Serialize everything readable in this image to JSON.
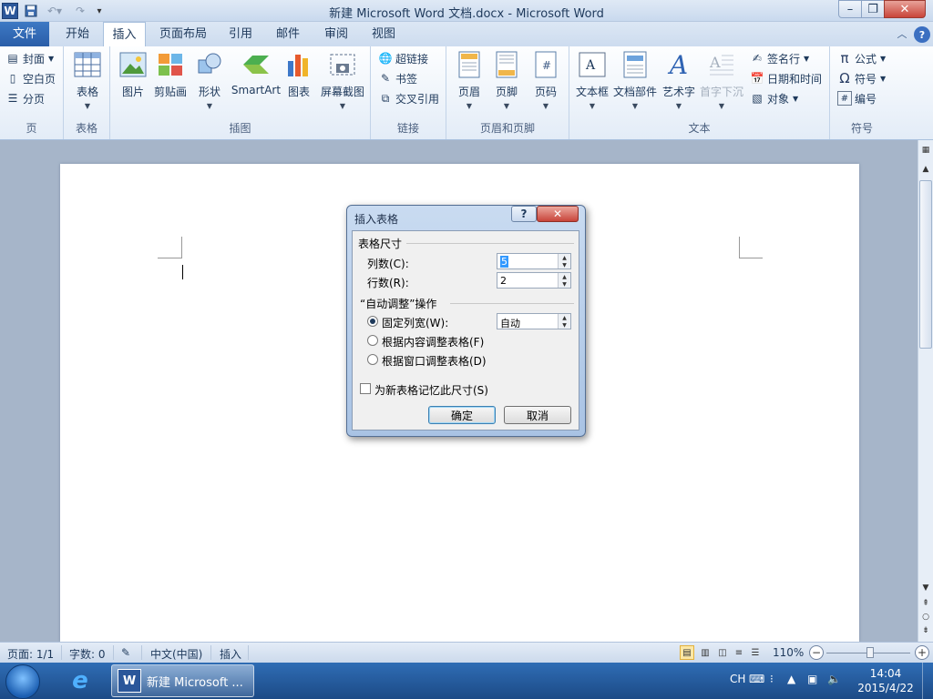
{
  "window": {
    "title": "新建 Microsoft Word 文档.docx - Microsoft Word",
    "app_icon": "W",
    "min": "–",
    "max": "❐",
    "close": "✕"
  },
  "tabs": [
    {
      "label": "文件"
    },
    {
      "label": "开始"
    },
    {
      "label": "插入",
      "active": true
    },
    {
      "label": "页面布局"
    },
    {
      "label": "引用"
    },
    {
      "label": "邮件"
    },
    {
      "label": "审阅"
    },
    {
      "label": "视图"
    }
  ],
  "ribbon": {
    "page_group": {
      "label": "页",
      "cover": "封面",
      "blank_page": "空白页",
      "page_break": "分页"
    },
    "table_group": {
      "label": "表格",
      "table": "表格"
    },
    "illustrations_group": {
      "label": "插图",
      "picture": "图片",
      "clipart": "剪贴画",
      "shapes": "形状",
      "smartart": "SmartArt",
      "chart": "图表",
      "screenshot": "屏幕截图"
    },
    "links_group": {
      "label": "链接",
      "hyperlink": "超链接",
      "bookmark": "书签",
      "cross_reference": "交叉引用"
    },
    "header_footer_group": {
      "label": "页眉和页脚",
      "header": "页眉",
      "footer": "页脚",
      "page_number": "页码"
    },
    "text_group": {
      "label": "文本",
      "textbox": "文本框",
      "quickparts": "文档部件",
      "wordart": "艺术字",
      "dropcap": "首字下沉",
      "signature_line": "签名行",
      "date_time": "日期和时间",
      "object": "对象"
    },
    "symbols_group": {
      "label": "符号",
      "equation": "公式",
      "symbol": "符号",
      "numbering": "编号"
    }
  },
  "dialog": {
    "title": "插入表格",
    "help": "?",
    "close": "✕",
    "size_section": "表格尺寸",
    "columns_label": "列数(C):",
    "columns_value": "5",
    "rows_label": "行数(R):",
    "rows_value": "2",
    "autofit_section": "“自动调整”操作",
    "fixed_width_label": "固定列宽(W):",
    "fixed_width_value": "自动",
    "autofit_contents_label": "根据内容调整表格(F)",
    "autofit_window_label": "根据窗口调整表格(D)",
    "remember_label": "为新表格记忆此尺寸(S)",
    "ok": "确定",
    "cancel": "取消"
  },
  "statusbar": {
    "page": "页面: 1/1",
    "words": "字数: 0",
    "language": "中文(中国)",
    "mode": "插入",
    "zoom": "110%"
  },
  "taskbar": {
    "word_task": "新建 Microsoft ...",
    "ime": "CH",
    "time": "14:04",
    "date": "2015/4/22"
  }
}
